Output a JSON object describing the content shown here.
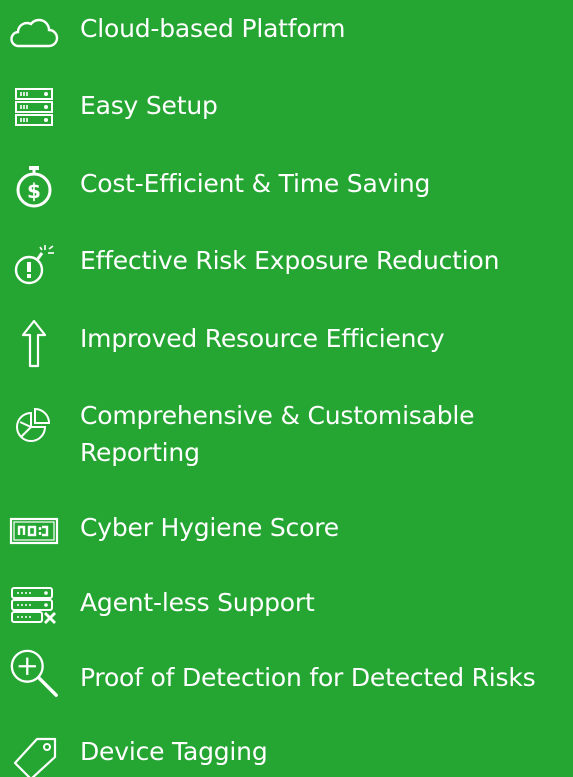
{
  "theme": {
    "background": "#25a632",
    "foreground": "#ffffff"
  },
  "features": [
    {
      "icon": "cloud-icon",
      "label": "Cloud-based Platform"
    },
    {
      "icon": "server-rack-icon",
      "label": "Easy Setup"
    },
    {
      "icon": "stopwatch-dollar-icon",
      "label": "Cost-Efficient & Time Saving"
    },
    {
      "icon": "bomb-icon",
      "label": "Effective Risk Exposure Reduction"
    },
    {
      "icon": "arrow-up-icon",
      "label": "Improved Resource Efficiency"
    },
    {
      "icon": "pie-chart-icon",
      "label": "Comprehensive & Customisable Reporting"
    },
    {
      "icon": "score-display-icon",
      "label": "Cyber Hygiene Score"
    },
    {
      "icon": "server-cross-icon",
      "label": "Agent-less Support"
    },
    {
      "icon": "magnify-plus-icon",
      "label": "Proof of Detection for Detected Risks"
    },
    {
      "icon": "tag-icon",
      "label": "Device Tagging"
    }
  ]
}
